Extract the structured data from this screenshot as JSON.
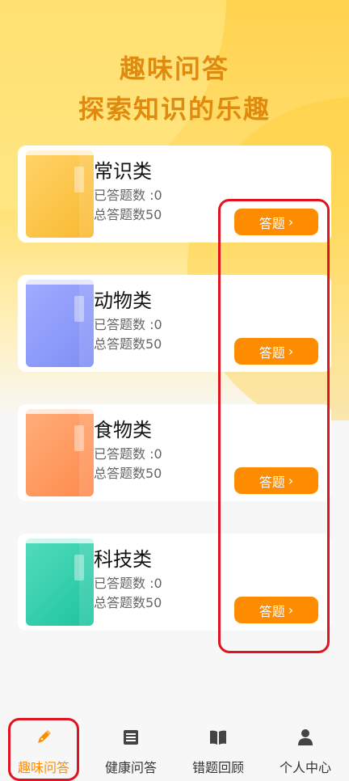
{
  "hero": {
    "line1": "趣味问答",
    "line2": "探索知识的乐趣"
  },
  "categories": [
    {
      "name": "常识类",
      "answered": "已答题数 :0",
      "total": "总答题数50",
      "button": "答题",
      "book_color": "#f9b92f",
      "book_color_light": "#ffd46a"
    },
    {
      "name": "动物类",
      "answered": "已答题数 :0",
      "total": "总答题数50",
      "button": "答题",
      "book_color": "#7f8ef5",
      "book_color_light": "#a0acff"
    },
    {
      "name": "食物类",
      "answered": "已答题数 :0",
      "total": "总答题数50",
      "button": "答题",
      "book_color": "#ff8a4c",
      "book_color_light": "#ffae7a"
    },
    {
      "name": "科技类",
      "answered": "已答题数 :0",
      "total": "总答题数50",
      "button": "答题",
      "book_color": "#1ec4a0",
      "book_color_light": "#52dcbc"
    }
  ],
  "tabs": [
    {
      "label": "趣味问答",
      "icon": "pen-icon",
      "active": true
    },
    {
      "label": "健康问答",
      "icon": "document-icon",
      "active": false
    },
    {
      "label": "错题回顾",
      "icon": "book-icon",
      "active": false
    },
    {
      "label": "个人中心",
      "icon": "person-icon",
      "active": false
    }
  ],
  "colors": {
    "accent": "#ff8c00",
    "hero_title": "#e08a10",
    "highlight": "#e0141e"
  }
}
